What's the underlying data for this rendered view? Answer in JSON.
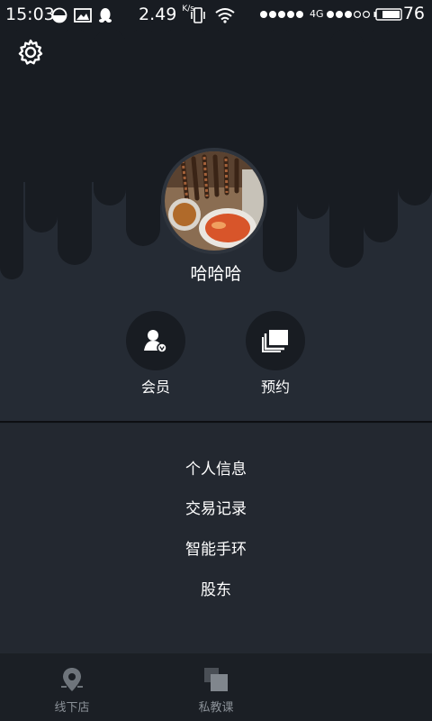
{
  "status_bar": {
    "time": "15:03",
    "speed_value": "2.49",
    "speed_unit": "K/s",
    "network": "4G",
    "battery": "76",
    "icons": [
      "half-moon-icon",
      "image-icon",
      "qq-icon",
      "vibrate-icon",
      "wifi-icon",
      "signal-dots-icon",
      "battery-icon"
    ]
  },
  "header": {
    "settings_icon": "gear-icon"
  },
  "profile": {
    "username": "哈哈哈",
    "avatar_alt": "food-photo"
  },
  "actions": [
    {
      "label": "会员",
      "icon": "member-icon"
    },
    {
      "label": "预约",
      "icon": "booking-icon"
    }
  ],
  "menu": {
    "items": [
      "个人信息",
      "交易记录",
      "智能手环",
      "股东"
    ]
  },
  "tabbar": {
    "tabs": [
      {
        "label": "线下店",
        "icon": "location-pin-icon"
      },
      {
        "label": "私教课",
        "icon": "stacked-squares-icon"
      }
    ]
  },
  "colors": {
    "background": "#20252d",
    "hero": "#252b34",
    "drip": "#181c22",
    "tab_text": "#8a9097"
  }
}
